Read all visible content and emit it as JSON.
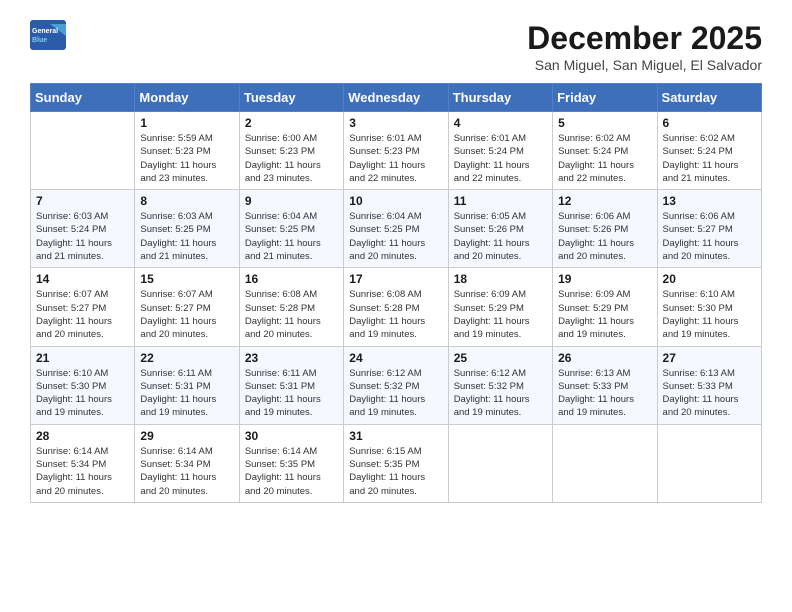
{
  "header": {
    "logo_line1": "General",
    "logo_line2": "Blue",
    "month": "December 2025",
    "location": "San Miguel, San Miguel, El Salvador"
  },
  "weekdays": [
    "Sunday",
    "Monday",
    "Tuesday",
    "Wednesday",
    "Thursday",
    "Friday",
    "Saturday"
  ],
  "weeks": [
    [
      {
        "day": "",
        "sunrise": "",
        "sunset": "",
        "daylight": ""
      },
      {
        "day": "1",
        "sunrise": "Sunrise: 5:59 AM",
        "sunset": "Sunset: 5:23 PM",
        "daylight": "Daylight: 11 hours and 23 minutes."
      },
      {
        "day": "2",
        "sunrise": "Sunrise: 6:00 AM",
        "sunset": "Sunset: 5:23 PM",
        "daylight": "Daylight: 11 hours and 23 minutes."
      },
      {
        "day": "3",
        "sunrise": "Sunrise: 6:01 AM",
        "sunset": "Sunset: 5:23 PM",
        "daylight": "Daylight: 11 hours and 22 minutes."
      },
      {
        "day": "4",
        "sunrise": "Sunrise: 6:01 AM",
        "sunset": "Sunset: 5:24 PM",
        "daylight": "Daylight: 11 hours and 22 minutes."
      },
      {
        "day": "5",
        "sunrise": "Sunrise: 6:02 AM",
        "sunset": "Sunset: 5:24 PM",
        "daylight": "Daylight: 11 hours and 22 minutes."
      },
      {
        "day": "6",
        "sunrise": "Sunrise: 6:02 AM",
        "sunset": "Sunset: 5:24 PM",
        "daylight": "Daylight: 11 hours and 21 minutes."
      }
    ],
    [
      {
        "day": "7",
        "sunrise": "Sunrise: 6:03 AM",
        "sunset": "Sunset: 5:24 PM",
        "daylight": "Daylight: 11 hours and 21 minutes."
      },
      {
        "day": "8",
        "sunrise": "Sunrise: 6:03 AM",
        "sunset": "Sunset: 5:25 PM",
        "daylight": "Daylight: 11 hours and 21 minutes."
      },
      {
        "day": "9",
        "sunrise": "Sunrise: 6:04 AM",
        "sunset": "Sunset: 5:25 PM",
        "daylight": "Daylight: 11 hours and 21 minutes."
      },
      {
        "day": "10",
        "sunrise": "Sunrise: 6:04 AM",
        "sunset": "Sunset: 5:25 PM",
        "daylight": "Daylight: 11 hours and 20 minutes."
      },
      {
        "day": "11",
        "sunrise": "Sunrise: 6:05 AM",
        "sunset": "Sunset: 5:26 PM",
        "daylight": "Daylight: 11 hours and 20 minutes."
      },
      {
        "day": "12",
        "sunrise": "Sunrise: 6:06 AM",
        "sunset": "Sunset: 5:26 PM",
        "daylight": "Daylight: 11 hours and 20 minutes."
      },
      {
        "day": "13",
        "sunrise": "Sunrise: 6:06 AM",
        "sunset": "Sunset: 5:27 PM",
        "daylight": "Daylight: 11 hours and 20 minutes."
      }
    ],
    [
      {
        "day": "14",
        "sunrise": "Sunrise: 6:07 AM",
        "sunset": "Sunset: 5:27 PM",
        "daylight": "Daylight: 11 hours and 20 minutes."
      },
      {
        "day": "15",
        "sunrise": "Sunrise: 6:07 AM",
        "sunset": "Sunset: 5:27 PM",
        "daylight": "Daylight: 11 hours and 20 minutes."
      },
      {
        "day": "16",
        "sunrise": "Sunrise: 6:08 AM",
        "sunset": "Sunset: 5:28 PM",
        "daylight": "Daylight: 11 hours and 20 minutes."
      },
      {
        "day": "17",
        "sunrise": "Sunrise: 6:08 AM",
        "sunset": "Sunset: 5:28 PM",
        "daylight": "Daylight: 11 hours and 19 minutes."
      },
      {
        "day": "18",
        "sunrise": "Sunrise: 6:09 AM",
        "sunset": "Sunset: 5:29 PM",
        "daylight": "Daylight: 11 hours and 19 minutes."
      },
      {
        "day": "19",
        "sunrise": "Sunrise: 6:09 AM",
        "sunset": "Sunset: 5:29 PM",
        "daylight": "Daylight: 11 hours and 19 minutes."
      },
      {
        "day": "20",
        "sunrise": "Sunrise: 6:10 AM",
        "sunset": "Sunset: 5:30 PM",
        "daylight": "Daylight: 11 hours and 19 minutes."
      }
    ],
    [
      {
        "day": "21",
        "sunrise": "Sunrise: 6:10 AM",
        "sunset": "Sunset: 5:30 PM",
        "daylight": "Daylight: 11 hours and 19 minutes."
      },
      {
        "day": "22",
        "sunrise": "Sunrise: 6:11 AM",
        "sunset": "Sunset: 5:31 PM",
        "daylight": "Daylight: 11 hours and 19 minutes."
      },
      {
        "day": "23",
        "sunrise": "Sunrise: 6:11 AM",
        "sunset": "Sunset: 5:31 PM",
        "daylight": "Daylight: 11 hours and 19 minutes."
      },
      {
        "day": "24",
        "sunrise": "Sunrise: 6:12 AM",
        "sunset": "Sunset: 5:32 PM",
        "daylight": "Daylight: 11 hours and 19 minutes."
      },
      {
        "day": "25",
        "sunrise": "Sunrise: 6:12 AM",
        "sunset": "Sunset: 5:32 PM",
        "daylight": "Daylight: 11 hours and 19 minutes."
      },
      {
        "day": "26",
        "sunrise": "Sunrise: 6:13 AM",
        "sunset": "Sunset: 5:33 PM",
        "daylight": "Daylight: 11 hours and 19 minutes."
      },
      {
        "day": "27",
        "sunrise": "Sunrise: 6:13 AM",
        "sunset": "Sunset: 5:33 PM",
        "daylight": "Daylight: 11 hours and 20 minutes."
      }
    ],
    [
      {
        "day": "28",
        "sunrise": "Sunrise: 6:14 AM",
        "sunset": "Sunset: 5:34 PM",
        "daylight": "Daylight: 11 hours and 20 minutes."
      },
      {
        "day": "29",
        "sunrise": "Sunrise: 6:14 AM",
        "sunset": "Sunset: 5:34 PM",
        "daylight": "Daylight: 11 hours and 20 minutes."
      },
      {
        "day": "30",
        "sunrise": "Sunrise: 6:14 AM",
        "sunset": "Sunset: 5:35 PM",
        "daylight": "Daylight: 11 hours and 20 minutes."
      },
      {
        "day": "31",
        "sunrise": "Sunrise: 6:15 AM",
        "sunset": "Sunset: 5:35 PM",
        "daylight": "Daylight: 11 hours and 20 minutes."
      },
      {
        "day": "",
        "sunrise": "",
        "sunset": "",
        "daylight": ""
      },
      {
        "day": "",
        "sunrise": "",
        "sunset": "",
        "daylight": ""
      },
      {
        "day": "",
        "sunrise": "",
        "sunset": "",
        "daylight": ""
      }
    ]
  ]
}
